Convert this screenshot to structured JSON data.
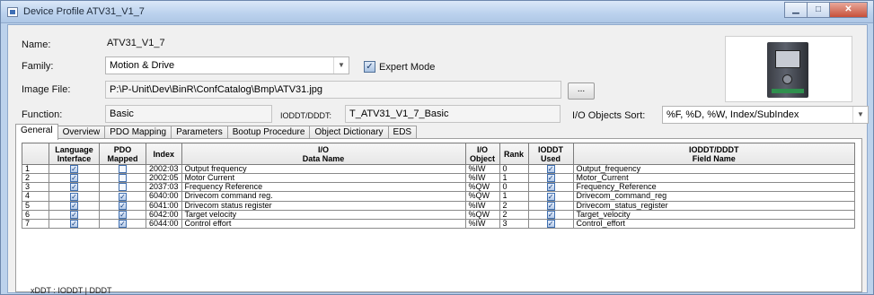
{
  "window": {
    "title": "Device Profile ATV31_V1_7",
    "min_label": "▁",
    "max_label": "□",
    "close_label": "✕"
  },
  "form": {
    "name_label": "Name:",
    "name_value": "ATV31_V1_7",
    "family_label": "Family:",
    "family_value": "Motion & Drive",
    "expert_mode_label": "Expert Mode",
    "expert_mode_checked": true,
    "image_file_label": "Image File:",
    "image_file_value": "P:\\P-Unit\\Dev\\BinR\\ConfCatalog\\Bmp\\ATV31.jpg",
    "browse_label": "...",
    "function_label": "Function:",
    "function_value": "Basic",
    "ioddt_label": "IODDT/DDDT:",
    "ioddt_value": "T_ATV31_V1_7_Basic",
    "io_sort_label": "I/O Objects Sort:",
    "io_sort_value": "%F, %D, %W, Index/SubIndex"
  },
  "tabs": [
    {
      "label": "General",
      "active": true
    },
    {
      "label": "Overview",
      "active": false
    },
    {
      "label": "PDO Mapping",
      "active": false
    },
    {
      "label": "Parameters",
      "active": false
    },
    {
      "label": "Bootup Procedure",
      "active": false
    },
    {
      "label": "Object Dictionary",
      "active": false
    },
    {
      "label": "EDS",
      "active": false
    }
  ],
  "table": {
    "headers": {
      "lang": [
        "Language",
        "Interface"
      ],
      "pdo": [
        "PDO",
        "Mapped"
      ],
      "index": "Index",
      "dataname": [
        "I/O",
        "Data Name"
      ],
      "ioobject": [
        "I/O",
        "Object"
      ],
      "rank": "Rank",
      "ioddt_used": [
        "IODDT",
        "Used"
      ],
      "fieldname": [
        "IODDT/DDDT",
        "Field Name"
      ]
    },
    "rows": [
      {
        "num": "1",
        "lang": true,
        "pdo": false,
        "index": "2002:03",
        "name": "Output frequency",
        "obj": "%IW",
        "rank": "0",
        "used": true,
        "field": "Output_frequency"
      },
      {
        "num": "2",
        "lang": true,
        "pdo": false,
        "index": "2002:05",
        "name": "Motor Current",
        "obj": "%IW",
        "rank": "1",
        "used": true,
        "field": "Motor_Current"
      },
      {
        "num": "3",
        "lang": true,
        "pdo": false,
        "index": "2037:03",
        "name": "Frequency Reference",
        "obj": "%QW",
        "rank": "0",
        "used": true,
        "field": "Frequency_Reference"
      },
      {
        "num": "4",
        "lang": true,
        "pdo": true,
        "index": "6040:00",
        "name": "Drivecom command reg.",
        "obj": "%QW",
        "rank": "1",
        "used": true,
        "field": "Drivecom_command_reg"
      },
      {
        "num": "5",
        "lang": true,
        "pdo": true,
        "index": "6041:00",
        "name": "Drivecom status register",
        "obj": "%IW",
        "rank": "2",
        "used": true,
        "field": "Drivecom_status_register"
      },
      {
        "num": "6",
        "lang": true,
        "pdo": true,
        "index": "6042:00",
        "name": "Target velocity",
        "obj": "%QW",
        "rank": "2",
        "used": true,
        "field": "Target_velocity"
      },
      {
        "num": "7",
        "lang": true,
        "pdo": true,
        "index": "6044:00",
        "name": "Control effort",
        "obj": "%IW",
        "rank": "3",
        "used": true,
        "field": "Control_effort"
      }
    ]
  },
  "footnote": "xDDT : IODDT | DDDT",
  "icons": {
    "window_icon": "window-icon",
    "dropdown": "chevron-down-icon",
    "device_image": "drive-image"
  }
}
